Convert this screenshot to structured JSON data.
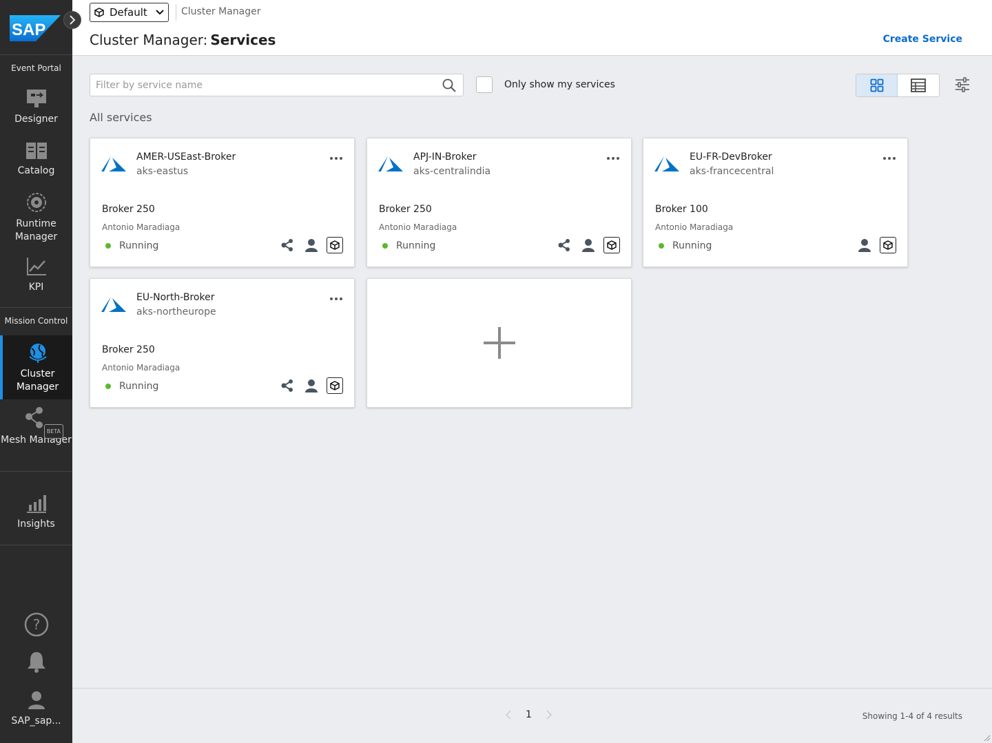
{
  "sidebar": {
    "section_event_portal": "Event Portal",
    "section_mission_control": "Mission Control",
    "items": [
      {
        "label": "Designer"
      },
      {
        "label": "Catalog"
      },
      {
        "label": "Runtime Manager"
      },
      {
        "label": "KPI"
      },
      {
        "label": "Cluster Manager"
      },
      {
        "label": "Mesh Manager"
      },
      {
        "label": "Insights"
      }
    ],
    "beta_badge": "BETA",
    "user_label": "SAP_sap...",
    "brand_logo_text": "SAP"
  },
  "header": {
    "environment": "Default",
    "breadcrumb": "Cluster Manager",
    "title_prefix": "Cluster Manager:",
    "title_main": "Services",
    "create_label": "Create Service"
  },
  "toolbar": {
    "filter_placeholder": "Filter by service name",
    "filter_value": "",
    "only_mine_label": "Only show my services",
    "only_mine_checked": false,
    "view_mode": "grid"
  },
  "section_title": "All services",
  "services": [
    {
      "name": "AMER-USEast-Broker",
      "cluster": "aks-eastus",
      "tier": "Broker 250",
      "owner": "Antonio Maradiaga",
      "status": "Running",
      "icons": [
        "mesh-icon",
        "user-icon",
        "cube-icon"
      ]
    },
    {
      "name": "APJ-IN-Broker",
      "cluster": "aks-centralindia",
      "tier": "Broker 250",
      "owner": "Antonio Maradiaga",
      "status": "Running",
      "icons": [
        "mesh-icon",
        "user-icon",
        "cube-icon"
      ]
    },
    {
      "name": "EU-FR-DevBroker",
      "cluster": "aks-francecentral",
      "tier": "Broker 100",
      "owner": "Antonio Maradiaga",
      "status": "Running",
      "icons": [
        "user-icon",
        "cube-icon"
      ]
    },
    {
      "name": "EU-North-Broker",
      "cluster": "aks-northeurope",
      "tier": "Broker 250",
      "owner": "Antonio Maradiaga",
      "status": "Running",
      "icons": [
        "mesh-icon",
        "user-icon",
        "cube-icon"
      ]
    }
  ],
  "footer": {
    "current_page": "1",
    "results": "Showing 1-4 of 4 results"
  },
  "colors": {
    "accent": "#0a6bd1",
    "sidebar_bg": "#2b2b2b",
    "status_running": "#5cb82e",
    "azure_blue": "#0072c6"
  }
}
